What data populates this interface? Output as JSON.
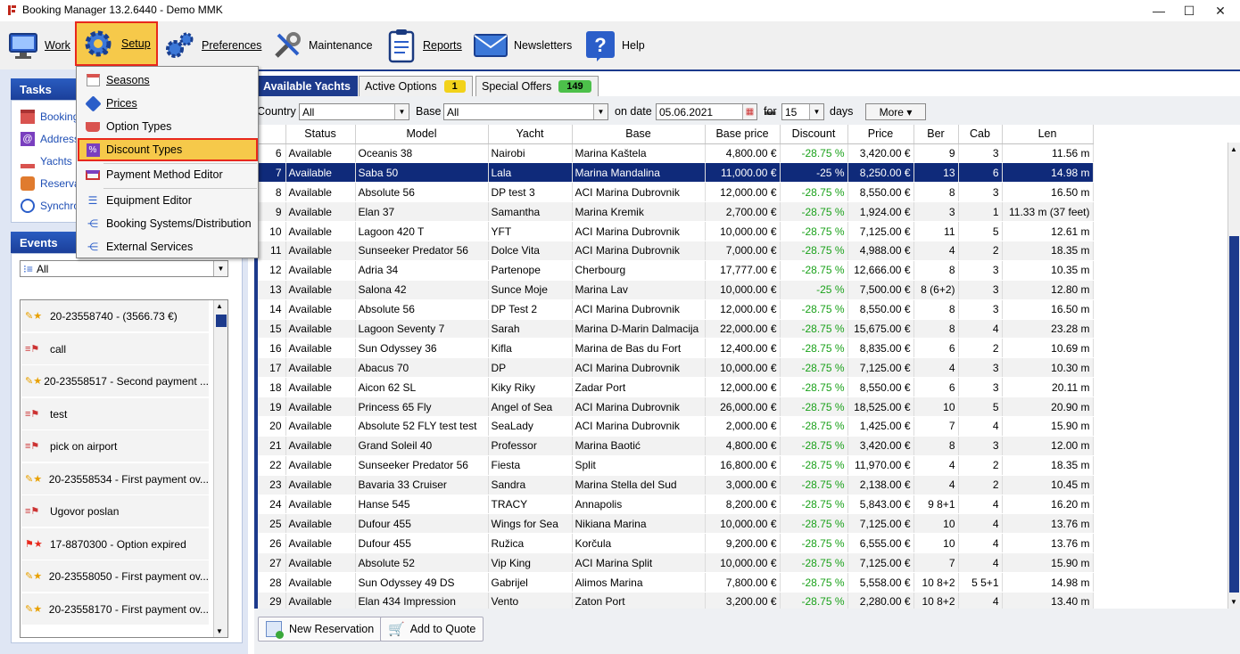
{
  "window": {
    "title": "Booking Manager 13.2.6440 - Demo MMK",
    "minimize": "—",
    "maximize": "☐",
    "close": "✕"
  },
  "toolbar": {
    "work": "Work",
    "setup": "Setup",
    "preferences": "Preferences",
    "maintenance": "Maintenance",
    "reports": "Reports",
    "newsletters": "Newsletters",
    "help": "Help"
  },
  "setup_menu": {
    "items": [
      "Seasons",
      "Prices",
      "Option Types",
      "Discount Types",
      "Payment Method Editor",
      "Equipment Editor",
      "Booking Systems/Distribution",
      "External Services"
    ]
  },
  "tasks": {
    "title": "Tasks",
    "items": [
      "Bookings",
      "Addresses",
      "Yachts",
      "Reservations",
      "Synchronize"
    ]
  },
  "events": {
    "title": "Events",
    "filter": "All",
    "items": [
      "20-23558740 -  (3566.73 €)",
      "call",
      "20-23558517 - Second payment ...",
      "test",
      "pick on airport",
      "20-23558534 - First payment ov...",
      "Ugovor poslan",
      "17-8870300 - Option expired",
      "20-23558050 - First payment ov...",
      "20-23558170 - First payment ov..."
    ]
  },
  "tabs": {
    "available": "Available Yachts",
    "active_options": "Active Options",
    "active_options_count": "1",
    "special_offers": "Special Offers",
    "special_offers_count": "149"
  },
  "filters": {
    "country_label": "Country",
    "country_value": "All",
    "base_label": "Base",
    "base_value": "All",
    "ondate_label": "on date",
    "date_value": "05.06.2021",
    "for_label": "for",
    "days_value": "15",
    "days_label": "days",
    "more": "More ▾"
  },
  "grid": {
    "columns": [
      "",
      "Status",
      "Model",
      "Yacht",
      "Base",
      "Base price",
      "Discount",
      "Price",
      "Ber",
      "Cab",
      "Len"
    ],
    "selected_row": 1,
    "rows": [
      [
        "6",
        "Available",
        "Oceanis 38",
        "Nairobi",
        "Marina Kaštela",
        "4,800.00 €",
        "-28.75 %",
        "3,420.00 €",
        "9",
        "3",
        "11.56 m"
      ],
      [
        "7",
        "Available",
        "Saba 50",
        "Lala",
        "Marina Mandalina",
        "11,000.00 €",
        "-25 %",
        "8,250.00 €",
        "13",
        "6",
        "14.98 m"
      ],
      [
        "8",
        "Available",
        "Absolute 56",
        "DP test 3",
        "ACI Marina Dubrovnik",
        "12,000.00 €",
        "-28.75 %",
        "8,550.00 €",
        "8",
        "3",
        "16.50 m"
      ],
      [
        "9",
        "Available",
        "Elan 37",
        "Samantha",
        "Marina Kremik",
        "2,700.00 €",
        "-28.75 %",
        "1,924.00 €",
        "3",
        "1",
        "11.33 m (37 feet)"
      ],
      [
        "10",
        "Available",
        "Lagoon 420 T",
        "YFT",
        "ACI Marina Dubrovnik",
        "10,000.00 €",
        "-28.75 %",
        "7,125.00 €",
        "11",
        "5",
        "12.61 m"
      ],
      [
        "11",
        "Available",
        "Sunseeker Predator 56",
        "Dolce Vita",
        "ACI Marina Dubrovnik",
        "7,000.00 €",
        "-28.75 %",
        "4,988.00 €",
        "4",
        "2",
        "18.35 m"
      ],
      [
        "12",
        "Available",
        "Adria 34",
        "Partenope",
        "Cherbourg",
        "17,777.00 €",
        "-28.75 %",
        "12,666.00 €",
        "8",
        "3",
        "10.35 m"
      ],
      [
        "13",
        "Available",
        "Salona 42",
        "Sunce Moje",
        "Marina Lav",
        "10,000.00 €",
        "-25 %",
        "7,500.00 €",
        "8 (6+2)",
        "3",
        "12.80 m"
      ],
      [
        "14",
        "Available",
        "Absolute 56",
        "DP Test 2",
        "ACI Marina Dubrovnik",
        "12,000.00 €",
        "-28.75 %",
        "8,550.00 €",
        "8",
        "3",
        "16.50 m"
      ],
      [
        "15",
        "Available",
        "Lagoon Seventy 7",
        "Sarah",
        "Marina D-Marin Dalmacija",
        "22,000.00 €",
        "-28.75 %",
        "15,675.00 €",
        "8",
        "4",
        "23.28 m"
      ],
      [
        "16",
        "Available",
        "Sun Odyssey 36",
        "Kifla",
        "Marina de Bas du Fort",
        "12,400.00 €",
        "-28.75 %",
        "8,835.00 €",
        "6",
        "2",
        "10.69 m"
      ],
      [
        "17",
        "Available",
        "Abacus 70",
        "DP",
        "ACI Marina Dubrovnik",
        "10,000.00 €",
        "-28.75 %",
        "7,125.00 €",
        "4",
        "3",
        "10.30 m"
      ],
      [
        "18",
        "Available",
        "Aicon 62 SL",
        "Kiky Riky",
        "Zadar Port",
        "12,000.00 €",
        "-28.75 %",
        "8,550.00 €",
        "6",
        "3",
        "20.11 m"
      ],
      [
        "19",
        "Available",
        "Princess 65 Fly",
        "Angel of Sea",
        "ACI Marina Dubrovnik",
        "26,000.00 €",
        "-28.75 %",
        "18,525.00 €",
        "10",
        "5",
        "20.90 m"
      ],
      [
        "20",
        "Available",
        "Absolute 52 FLY test test",
        "SeaLady",
        "ACI Marina Dubrovnik",
        "2,000.00 €",
        "-28.75 %",
        "1,425.00 €",
        "7",
        "4",
        "15.90 m"
      ],
      [
        "21",
        "Available",
        "Grand Soleil 40",
        "Professor",
        "Marina Baotić",
        "4,800.00 €",
        "-28.75 %",
        "3,420.00 €",
        "8",
        "3",
        "12.00 m"
      ],
      [
        "22",
        "Available",
        "Sunseeker Predator 56",
        "Fiesta",
        "Split",
        "16,800.00 €",
        "-28.75 %",
        "11,970.00 €",
        "4",
        "2",
        "18.35 m"
      ],
      [
        "23",
        "Available",
        "Bavaria 33 Cruiser",
        "Sandra",
        "Marina Stella del Sud",
        "3,000.00 €",
        "-28.75 %",
        "2,138.00 €",
        "4",
        "2",
        "10.45 m"
      ],
      [
        "24",
        "Available",
        "Hanse 545",
        "TRACY",
        "Annapolis",
        "8,200.00 €",
        "-28.75 %",
        "5,843.00 €",
        "9 8+1",
        "4",
        "16.20 m"
      ],
      [
        "25",
        "Available",
        "Dufour 455",
        "Wings for Sea",
        "Nikiana Marina",
        "10,000.00 €",
        "-28.75 %",
        "7,125.00 €",
        "10",
        "4",
        "13.76 m"
      ],
      [
        "26",
        "Available",
        "Dufour 455",
        "Ružica",
        "Korčula",
        "9,200.00 €",
        "-28.75 %",
        "6,555.00 €",
        "10",
        "4",
        "13.76 m"
      ],
      [
        "27",
        "Available",
        "Absolute 52",
        "Vip King",
        "ACI Marina Split",
        "10,000.00 €",
        "-28.75 %",
        "7,125.00 €",
        "7",
        "4",
        "15.90 m"
      ],
      [
        "28",
        "Available",
        "Sun Odyssey 49 DS",
        "Gabrijel",
        "Alimos Marina",
        "7,800.00 €",
        "-28.75 %",
        "5,558.00 €",
        "10 8+2",
        "5 5+1",
        "14.98 m"
      ],
      [
        "29",
        "Available",
        "Elan 434 Impression",
        "Vento",
        "Zaton Port",
        "3,200.00 €",
        "-28.75 %",
        "2,280.00 €",
        "10 8+2",
        "4",
        "13.40 m"
      ]
    ]
  },
  "bottom": {
    "new_reservation": "New Reservation",
    "add_to_quote": "Add to Quote"
  },
  "colors": {
    "accent_blue": "#1c3a8c",
    "highlight": "#f6c94a",
    "highlight_border": "#e8281c",
    "discount_green": "#1aa11a"
  }
}
